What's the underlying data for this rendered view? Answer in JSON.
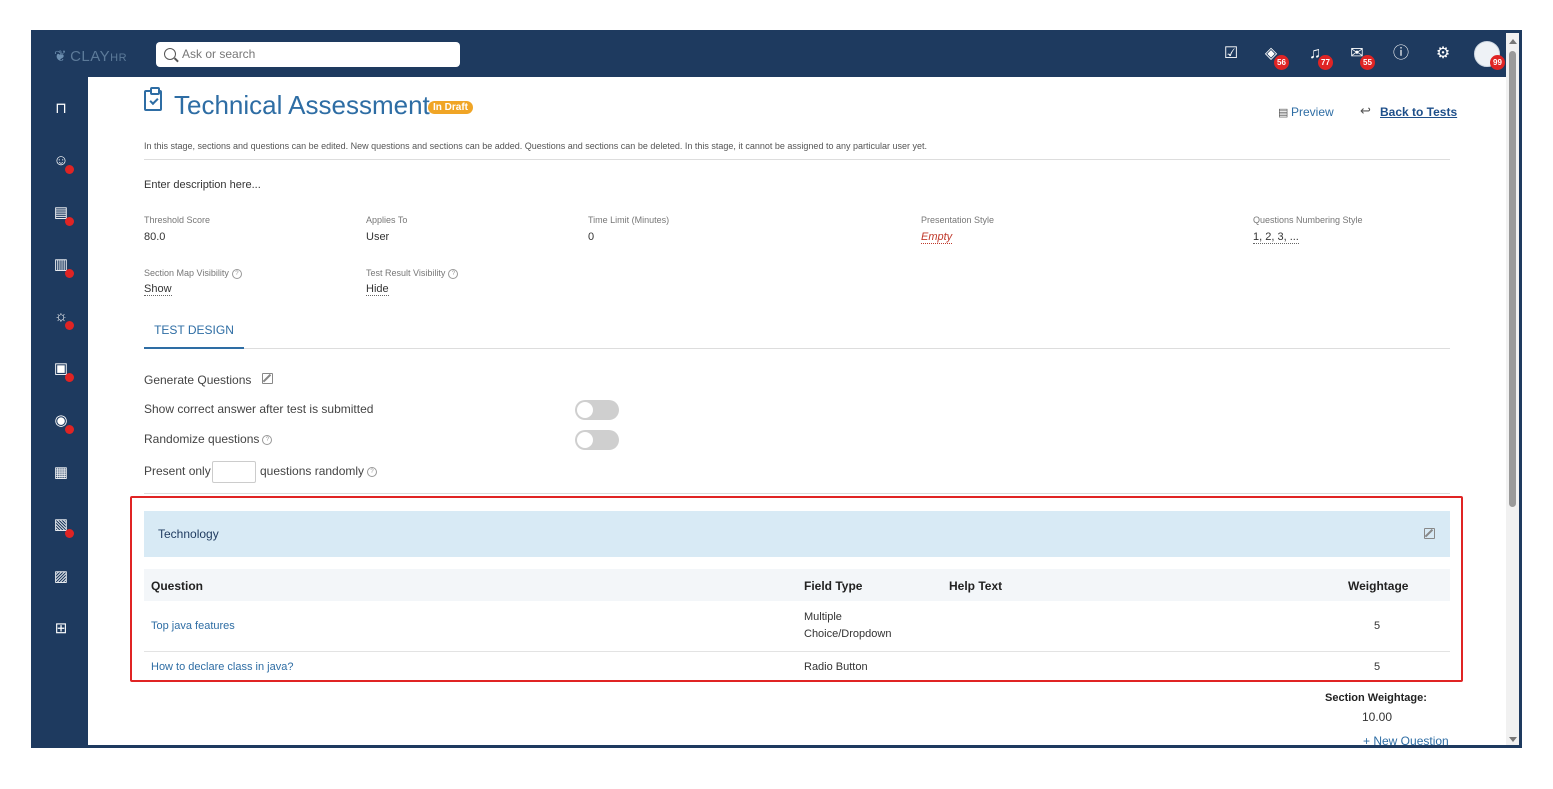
{
  "app": {
    "logo_text": "CLAY",
    "logo_suffix": "HR"
  },
  "search": {
    "placeholder": "Ask or search"
  },
  "topbar": {
    "icons": [
      {
        "name": "tasks-icon",
        "badge": null
      },
      {
        "name": "layers-icon",
        "badge": "56"
      },
      {
        "name": "bell-icon",
        "badge": "77"
      },
      {
        "name": "mail-icon",
        "badge": "55"
      },
      {
        "name": "help-icon",
        "badge": null
      },
      {
        "name": "settings-icon",
        "badge": null
      }
    ],
    "avatar_badge": "99"
  },
  "sidebar": {
    "items": [
      {
        "name": "bookmark-icon",
        "dot": false
      },
      {
        "name": "people-icon",
        "dot": true
      },
      {
        "name": "finance-icon",
        "dot": true
      },
      {
        "name": "analytics-icon",
        "dot": true
      },
      {
        "name": "ideas-icon",
        "dot": true
      },
      {
        "name": "documents-icon",
        "dot": true
      },
      {
        "name": "profile-icon",
        "dot": true
      },
      {
        "name": "reports-icon",
        "dot": false
      },
      {
        "name": "training-icon",
        "dot": true
      },
      {
        "name": "clipboard-icon",
        "dot": false
      },
      {
        "name": "apps-grid-icon",
        "dot": false
      }
    ]
  },
  "page": {
    "title": "Technical Assessment",
    "status_badge": "In Draft",
    "preview_label": "Preview",
    "back_label": "Back to Tests",
    "info_text": "In this stage, sections and questions can be edited. New questions and sections can be added. Questions and sections can be deleted. In this stage, it cannot be assigned to any particular user yet.",
    "description": "Enter description here..."
  },
  "fields": {
    "threshold": {
      "label": "Threshold Score",
      "value": "80.0"
    },
    "applies_to": {
      "label": "Applies To",
      "value": "User"
    },
    "time_limit": {
      "label": "Time Limit (Minutes)",
      "value": "0"
    },
    "presentation": {
      "label": "Presentation Style",
      "value": "Empty"
    },
    "numbering": {
      "label": "Questions Numbering Style",
      "value": "1, 2, 3, ..."
    },
    "section_map": {
      "label": "Section Map Visibility",
      "value": "Show"
    },
    "test_result": {
      "label": "Test Result Visibility",
      "value": "Hide"
    }
  },
  "tabs": {
    "test_design": "TEST DESIGN"
  },
  "options": {
    "generate_questions": "Generate Questions",
    "show_correct": "Show correct answer after test is submitted",
    "show_correct_on": false,
    "randomize": "Randomize questions",
    "randomize_on": false,
    "present_only": "Present only",
    "questions_randomly": "questions randomly"
  },
  "section": {
    "name": "Technology",
    "columns": {
      "question": "Question",
      "field_type": "Field Type",
      "help_text": "Help Text",
      "weightage": "Weightage"
    },
    "rows": [
      {
        "question": "Top java features",
        "field_type_1": "Multiple",
        "field_type_2": "Choice/Dropdown",
        "help_text": "",
        "weightage": "5"
      },
      {
        "question": "How to declare class in java?",
        "field_type_1": "Radio Button",
        "field_type_2": "",
        "help_text": "",
        "weightage": "5"
      }
    ],
    "section_weightage_label": "Section Weightage:",
    "section_weightage_value": "10.00",
    "new_question": "+ New Question"
  },
  "colors": {
    "navy": "#1e3a5f",
    "accent": "#2e6da4",
    "badge_red": "#e02424",
    "draft_orange": "#f0a526",
    "highlight": "#e02424"
  }
}
